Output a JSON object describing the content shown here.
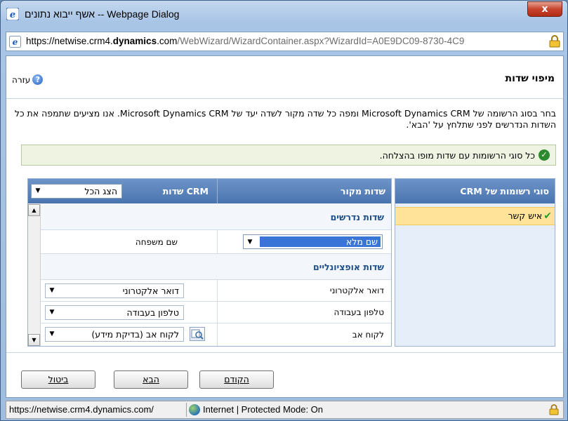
{
  "window": {
    "title": "אשף ייבוא נתונים -- Webpage Dialog",
    "close_label": "x"
  },
  "address_bar": {
    "url_prefix": "https://netwise.crm4.",
    "url_bold": "dynamics",
    "url_host_end": ".com",
    "url_path": "/WebWizard/WizardContainer.aspx?WizardId=A0E9DC09-8730-4C9"
  },
  "header": {
    "title": "מיפוי שדות",
    "help_label": "עזרה"
  },
  "description": "בחר בסוג הרשומה של Microsoft Dynamics CRM ומפה כל שדה מקור לשדה יעד של Microsoft Dynamics CRM. אנו מציעים שתמפה את כל השדות הנדרשים לפני שתלחץ על 'הבא'.",
  "success_message": "כל סוגי הרשומות עם שדות מופו בהצלחה.",
  "record_types": {
    "header": "סוגי רשומות של CRM",
    "items": [
      {
        "label": "איש קשר",
        "selected": true
      }
    ]
  },
  "mapping": {
    "source_header": "שדות מקור",
    "crm_header": "שדות CRM",
    "show_filter": "הצג הכל",
    "required_section": "שדות נדרשים",
    "optional_section": "שדות אופציונליים",
    "required_rows": [
      {
        "source_value": "שם מלא",
        "target": "שם משפחה"
      }
    ],
    "optional_rows": [
      {
        "source": "דואר אלקטרוני",
        "target": "דואר אלקטרוני"
      },
      {
        "source": "טלפון בעבודה",
        "target": "טלפון בעבודה"
      },
      {
        "source": "לקוח אב",
        "target": "לקוח אב (בדיקת מידע)"
      }
    ]
  },
  "footer": {
    "back_label": "הקודם",
    "next_label": "הבא",
    "cancel_label": "ביטול"
  },
  "status_bar": {
    "url": "https://netwise.crm4.dynamics.com/",
    "zone": "Internet | Protected Mode: On"
  },
  "colors": {
    "accent_header": "#4a74ae",
    "selected_item": "#ffe398",
    "success_bg": "#eef3e2",
    "success_icon": "#2e8a2e"
  }
}
